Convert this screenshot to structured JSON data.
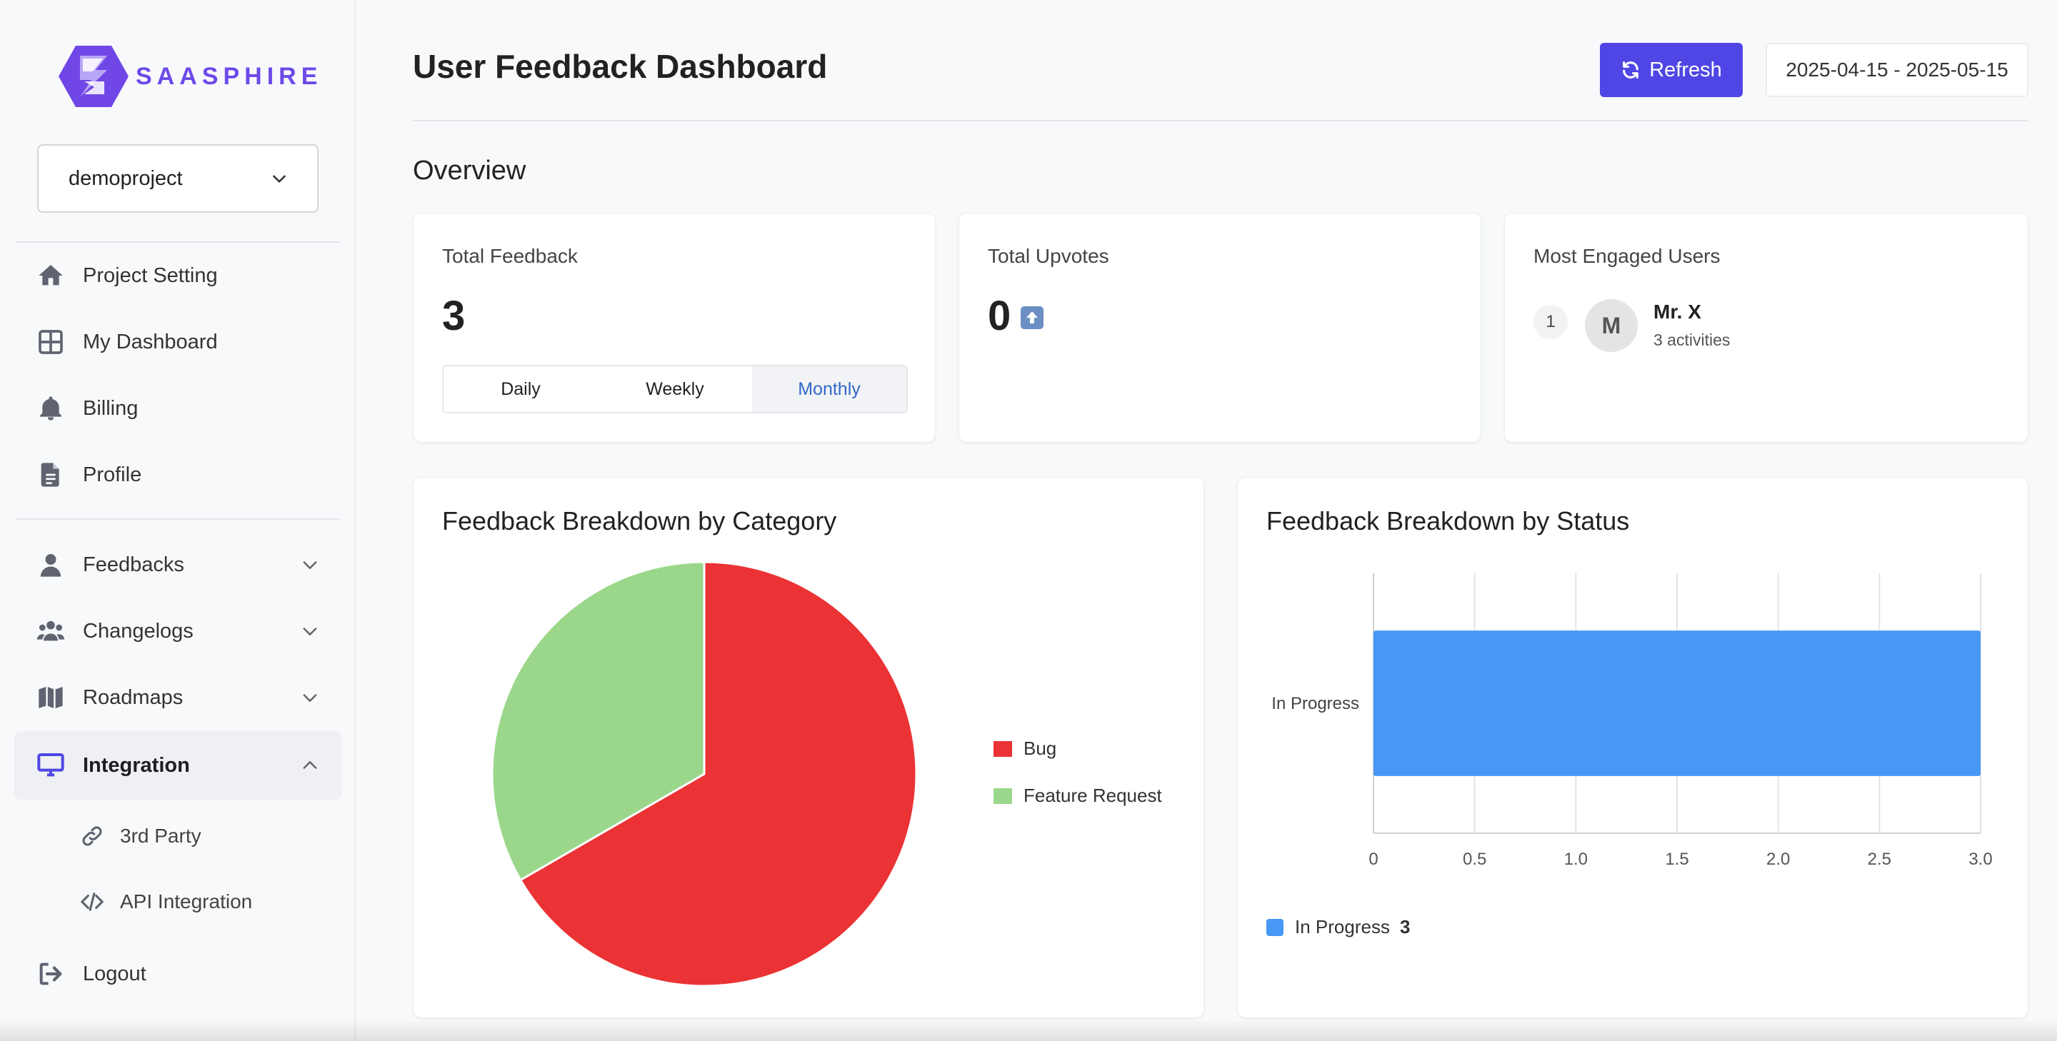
{
  "brand": {
    "name": "SAASPHIRE",
    "accent": "#6d4ae8"
  },
  "project_select": {
    "value": "demoproject"
  },
  "nav": {
    "primary": [
      {
        "label": "Project Setting",
        "icon": "home-icon"
      },
      {
        "label": "My Dashboard",
        "icon": "dashboard-grid-icon"
      },
      {
        "label": "Billing",
        "icon": "bell-icon"
      },
      {
        "label": "Profile",
        "icon": "document-icon"
      }
    ],
    "secondary": [
      {
        "label": "Feedbacks",
        "icon": "user-icon"
      },
      {
        "label": "Changelogs",
        "icon": "users-icon"
      },
      {
        "label": "Roadmaps",
        "icon": "map-icon"
      },
      {
        "label": "Integration",
        "icon": "monitor-icon"
      }
    ],
    "integration_sub": [
      {
        "label": "3rd Party",
        "icon": "link-icon"
      },
      {
        "label": "API Integration",
        "icon": "code-icon"
      }
    ],
    "logout": {
      "label": "Logout",
      "icon": "logout-icon"
    }
  },
  "header": {
    "title": "User Feedback Dashboard",
    "refresh_label": "Refresh",
    "date_range": "2025-04-15 - 2025-05-15",
    "button_color": "#4f46e5"
  },
  "overview": {
    "title": "Overview",
    "total_feedback": {
      "label": "Total Feedback",
      "value": "3",
      "periods": [
        "Daily",
        "Weekly",
        "Monthly"
      ],
      "selected_period": "Monthly"
    },
    "total_upvotes": {
      "label": "Total Upvotes",
      "value": "0"
    },
    "engaged_users": {
      "label": "Most Engaged Users",
      "users": [
        {
          "rank": "1",
          "initial": "M",
          "name": "Mr. X",
          "activity": "3 activities"
        }
      ]
    }
  },
  "charts": {
    "category": {
      "title": "Feedback Breakdown by Category"
    },
    "status": {
      "title": "Feedback Breakdown by Status"
    }
  },
  "chart_data": [
    {
      "type": "pie",
      "title": "Feedback Breakdown by Category",
      "categories": [
        "Bug",
        "Feature Request"
      ],
      "values": [
        2,
        1
      ],
      "colors": [
        "#eb3234",
        "#9bd78b"
      ],
      "legend": "right"
    },
    {
      "type": "bar",
      "orientation": "horizontal",
      "title": "Feedback Breakdown by Status",
      "categories": [
        "In Progress"
      ],
      "values": [
        3
      ],
      "series": [
        {
          "name": "In Progress",
          "values": [
            3
          ]
        }
      ],
      "xlim": [
        0,
        3
      ],
      "x_ticks": [
        "0",
        "0.5",
        "1.0",
        "1.5",
        "2.0",
        "2.5",
        "3.0"
      ],
      "grid": true,
      "colors": [
        "#4797f5"
      ],
      "legend": "bottom",
      "legend_value": "3"
    }
  ]
}
